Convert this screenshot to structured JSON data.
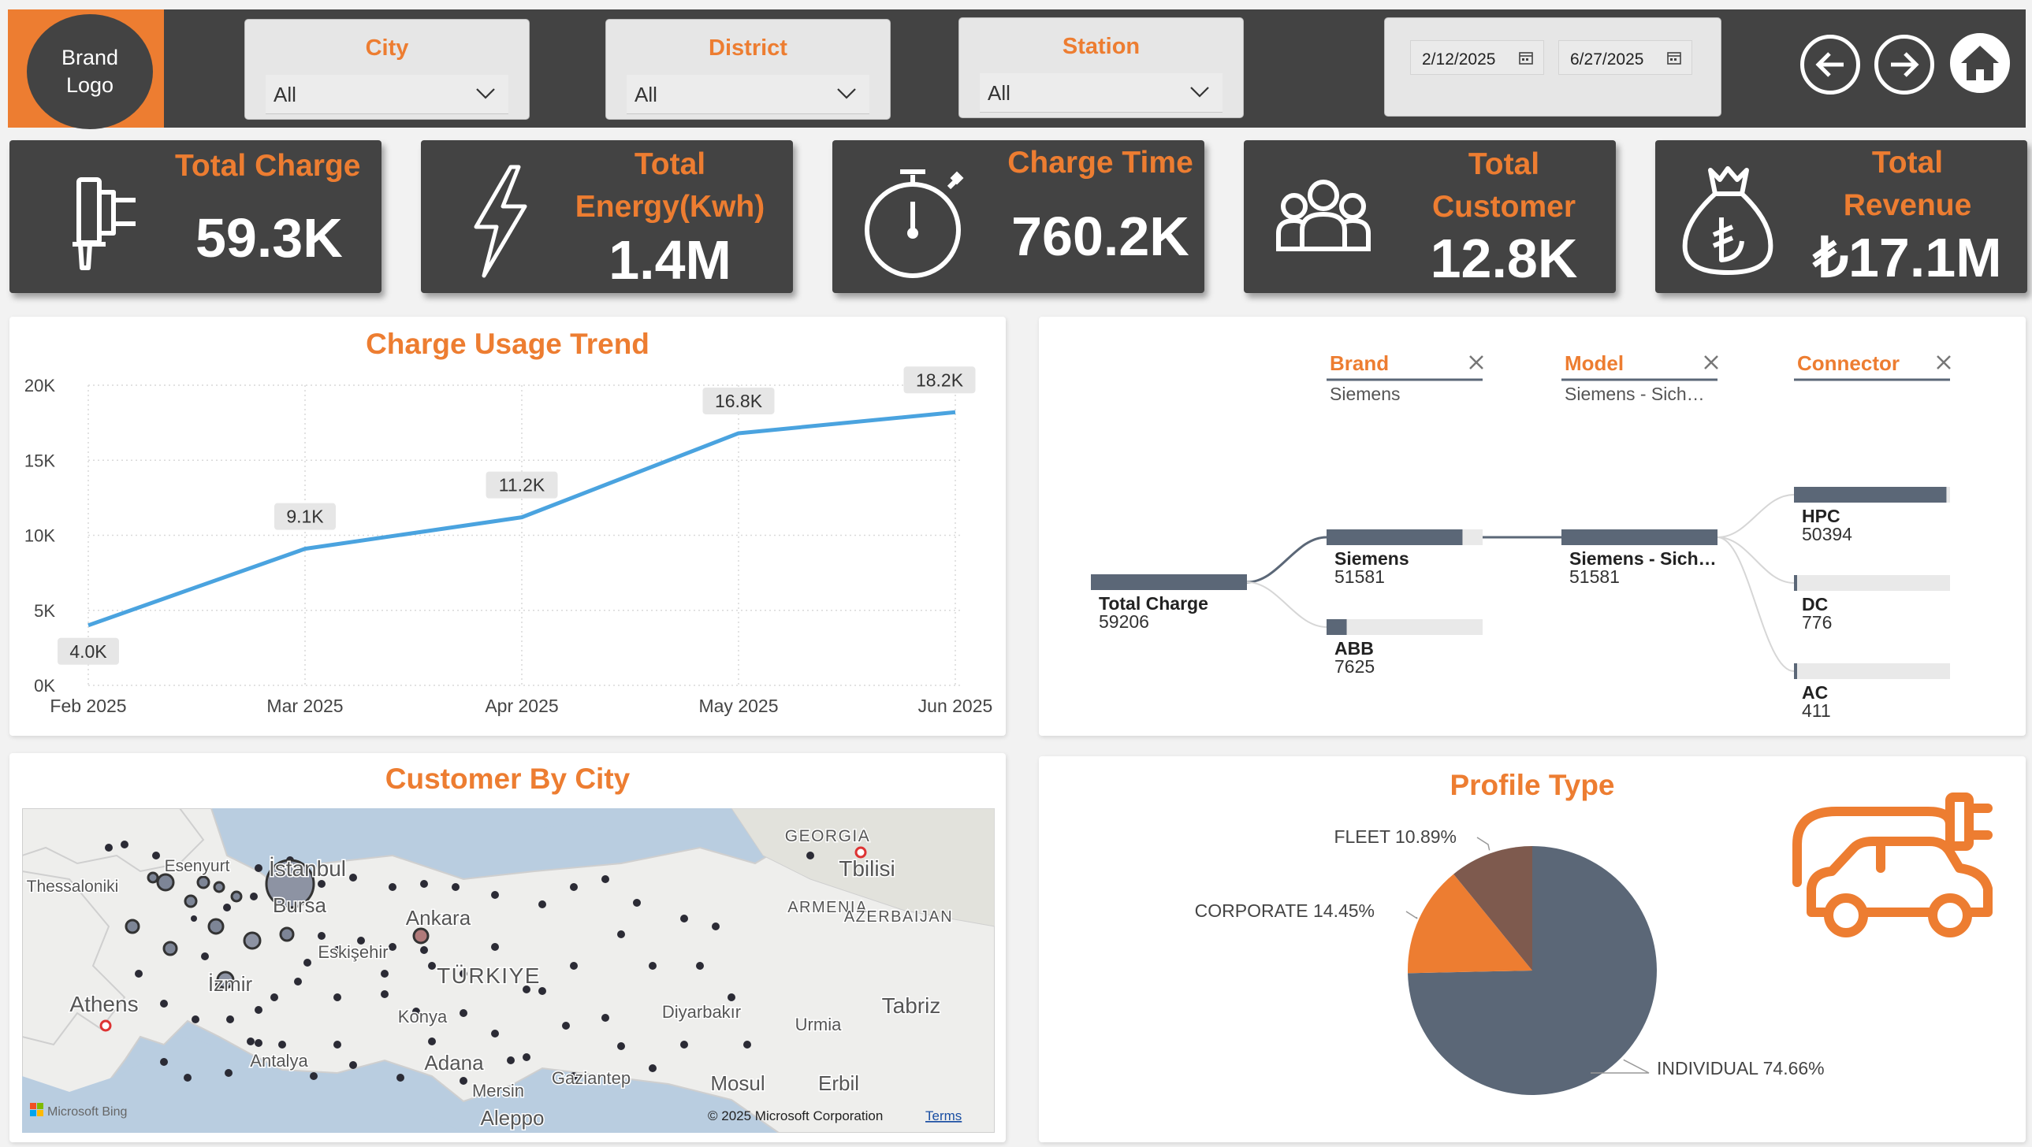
{
  "header": {
    "logo_text": "Brand\nLogo",
    "slicers": [
      {
        "title": "City",
        "value": "All"
      },
      {
        "title": "District",
        "value": "All"
      },
      {
        "title": "Station",
        "value": "All"
      }
    ],
    "date_start": "2/12/2025",
    "date_end": "6/27/2025",
    "nav": [
      "back-arrow-icon",
      "forward-arrow-icon",
      "home-icon"
    ]
  },
  "kpis": [
    {
      "title": "Total Charge",
      "value": "59.3K",
      "icon": "plug-icon"
    },
    {
      "title": "Total\nEnergy(Kwh)",
      "value": "1.4M",
      "icon": "lightning-icon"
    },
    {
      "title": "Charge Time",
      "value": "760.2K",
      "icon": "stopwatch-icon"
    },
    {
      "title": "Total\nCustomer",
      "value": "12.8K",
      "icon": "users-icon"
    },
    {
      "title": "Total\nRevenue",
      "value": "₺17.1M",
      "icon": "money-bag-icon"
    }
  ],
  "trend": {
    "title": "Charge Usage Trend",
    "chart_data": {
      "type": "line",
      "categories": [
        "Feb 2025",
        "Mar 2025",
        "Apr 2025",
        "May 2025",
        "Jun 2025"
      ],
      "values": [
        4000,
        9100,
        11200,
        16800,
        18200
      ],
      "data_labels": [
        "4.0K",
        "9.1K",
        "11.2K",
        "16.8K",
        "18.2K"
      ],
      "ylim": [
        0,
        20000
      ],
      "yticks": [
        "0K",
        "5K",
        "10K",
        "15K",
        "20K"
      ],
      "grid": true,
      "color": "#4aa3df"
    }
  },
  "decomp": {
    "levels": [
      {
        "name": "Brand",
        "selected": "Siemens"
      },
      {
        "name": "Model",
        "selected": "Siemens - Sich…"
      },
      {
        "name": "Connector",
        "selected": ""
      }
    ],
    "root": {
      "label": "Total Charge",
      "value": "59206"
    },
    "brand_nodes": [
      {
        "label": "Siemens",
        "value": "51581",
        "share": 0.871
      },
      {
        "label": "ABB",
        "value": "7625",
        "share": 0.129
      }
    ],
    "model_nodes": [
      {
        "label": "Siemens - Sich…",
        "value": "51581",
        "share": 1.0
      }
    ],
    "connector_nodes": [
      {
        "label": "HPC",
        "value": "50394",
        "share": 0.977
      },
      {
        "label": "DC",
        "value": "776",
        "share": 0.015
      },
      {
        "label": "AC",
        "value": "411",
        "share": 0.008
      }
    ]
  },
  "map": {
    "title": "Customer By City",
    "labels": [
      "Thessaloniki",
      "Esenyurt",
      "İstanbul",
      "Bursa",
      "Ankara",
      "Eskişehir",
      "TÜRKIYE",
      "İzmir",
      "Athens",
      "Konya",
      "Antalya",
      "Adana",
      "Mersin",
      "Gaziantep",
      "Diyarbakır",
      "Urmia",
      "Mosul",
      "Erbil",
      "Aleppo",
      "GEORGIA",
      "Tbilisi",
      "ARMENIA",
      "AZERBAIJAN",
      "Tabriz"
    ],
    "attribution": "Microsoft Bing",
    "copyright": "© 2025 Microsoft Corporation",
    "terms": "Terms"
  },
  "profile": {
    "title": "Profile Type",
    "chart_data": {
      "type": "pie",
      "categories": [
        "INDIVIDUAL",
        "CORPORATE",
        "FLEET"
      ],
      "values": [
        74.66,
        14.45,
        10.89
      ],
      "labels": [
        "INDIVIDUAL 74.66%",
        "CORPORATE 14.45%",
        "FLEET 10.89%"
      ],
      "colors": [
        "#5b6777",
        "#ed7d31",
        "#7e5a4e"
      ]
    },
    "icon": "ev-car-icon"
  }
}
